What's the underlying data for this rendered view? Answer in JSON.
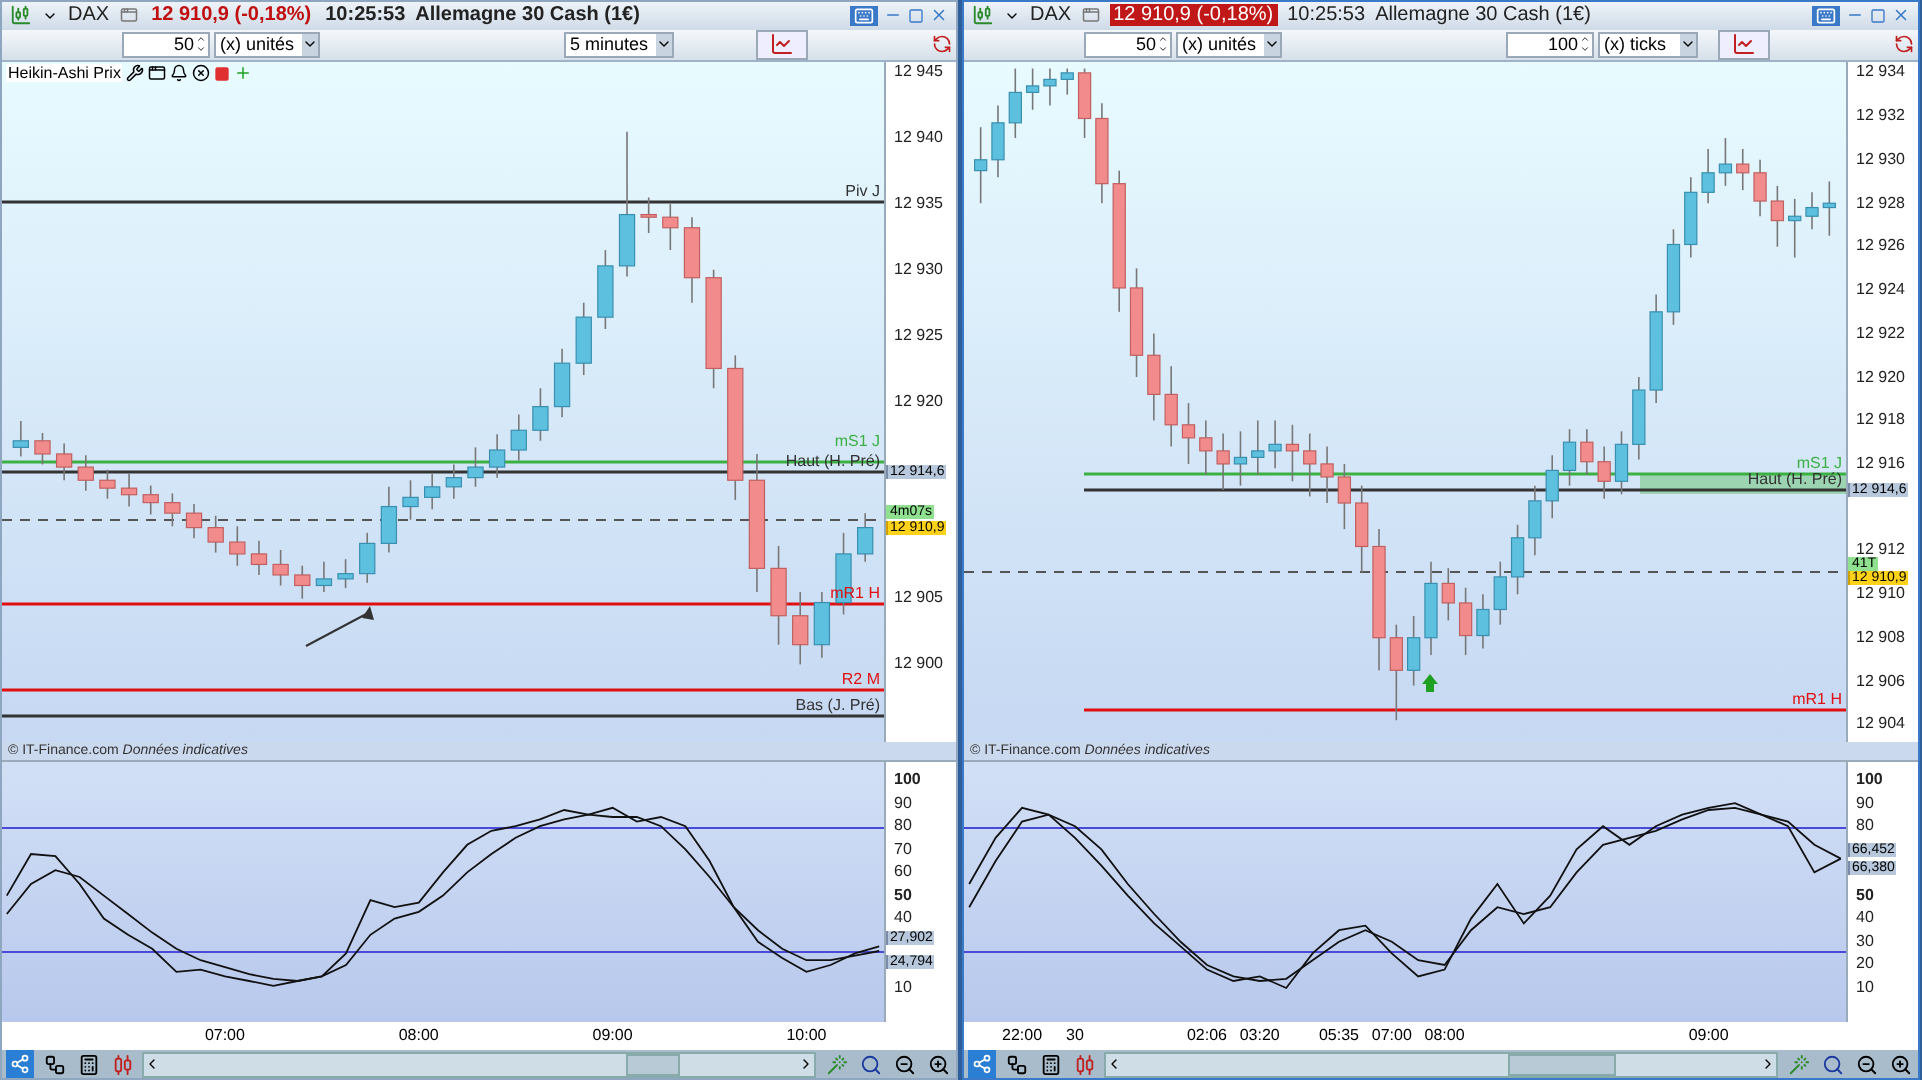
{
  "windows": [
    {
      "active": false,
      "title": {
        "symbol": "DAX",
        "quote": "12 910,9 (-0,18%)",
        "time": "10:25:53",
        "instrument": "Allemagne 30 Cash (1€)"
      },
      "toolbar": [
        {
          "kind": "spinner",
          "value": "50"
        },
        {
          "kind": "dropdown",
          "value": "(x) unités"
        },
        {
          "kind": "dropdown",
          "value": "5 minutes"
        }
      ],
      "indicator": "Heikin-Ashi Prix",
      "levels": [
        {
          "label": "Piv J",
          "color": "#333333"
        },
        {
          "label": "mS1 J",
          "color": "#3cb043"
        },
        {
          "label": "Haut (H. Pré)",
          "color": "#333333"
        },
        {
          "label": "mR1 H",
          "color": "#e01010"
        },
        {
          "label": "R2 M",
          "color": "#e01010"
        },
        {
          "label": "Bas (J. Pré)",
          "color": "#333333"
        }
      ],
      "price_chart": {
        "chart_data": {
          "type": "candlestick",
          "ylim": [
            12894.1,
            12945.8
          ],
          "yticks": [
            {
              "value": 12945,
              "label": "12 945"
            },
            {
              "value": 12940,
              "label": "12 940"
            },
            {
              "value": 12935,
              "label": "12 935"
            },
            {
              "value": 12930,
              "label": "12 930"
            },
            {
              "value": 12925,
              "label": "12 925"
            },
            {
              "value": 12920,
              "label": "12 920"
            },
            {
              "value": 12905,
              "label": "12 905"
            },
            {
              "value": 12900,
              "label": "12 900"
            }
          ],
          "categories": [
            null,
            null,
            null,
            null,
            null,
            null,
            null,
            null,
            null,
            null,
            null,
            null,
            null,
            null,
            null,
            null,
            null,
            null,
            null,
            null,
            null,
            null,
            null,
            null,
            null,
            null,
            null,
            null,
            null,
            null,
            null,
            null,
            null,
            null,
            null,
            null,
            null,
            null,
            null,
            null
          ],
          "ohlc": [
            [
              12916.5,
              12918.5,
              12915.8,
              12917.0
            ],
            [
              12917.0,
              12917.6,
              12915.2,
              12916.0
            ],
            [
              12916.0,
              12916.8,
              12914.0,
              12915.0
            ],
            [
              12915.0,
              12915.9,
              12913.2,
              12914.0
            ],
            [
              12914.0,
              12914.8,
              12912.6,
              12913.4
            ],
            [
              12913.4,
              12914.5,
              12912.0,
              12912.9
            ],
            [
              12912.9,
              12913.6,
              12911.4,
              12912.3
            ],
            [
              12912.3,
              12913.0,
              12910.5,
              12911.5
            ],
            [
              12911.5,
              12912.2,
              12909.6,
              12910.4
            ],
            [
              12910.4,
              12911.3,
              12908.5,
              12909.3
            ],
            [
              12909.3,
              12910.5,
              12907.5,
              12908.4
            ],
            [
              12908.4,
              12909.4,
              12906.8,
              12907.6
            ],
            [
              12907.6,
              12908.7,
              12906.0,
              12906.8
            ],
            [
              12906.8,
              12907.5,
              12905.0,
              12906.0
            ],
            [
              12906.0,
              12907.8,
              12905.5,
              12906.5
            ],
            [
              12906.5,
              12908.0,
              12905.8,
              12906.9
            ],
            [
              12906.9,
              12910.0,
              12906.2,
              12909.2
            ],
            [
              12909.2,
              12913.5,
              12908.5,
              12912.0
            ],
            [
              12912.0,
              12914.0,
              12911.0,
              12912.7
            ],
            [
              12912.7,
              12914.5,
              12911.8,
              12913.5
            ],
            [
              12913.5,
              12915.2,
              12912.6,
              12914.2
            ],
            [
              12914.2,
              12916.5,
              12913.5,
              12915.0
            ],
            [
              12915.0,
              12917.5,
              12914.2,
              12916.3
            ],
            [
              12916.3,
              12919.0,
              12915.5,
              12917.8
            ],
            [
              12917.8,
              12921.0,
              12917.0,
              12919.6
            ],
            [
              12919.6,
              12924.0,
              12918.8,
              12922.9
            ],
            [
              12922.9,
              12927.5,
              12922.0,
              12926.4
            ],
            [
              12926.4,
              12931.5,
              12925.5,
              12930.3
            ],
            [
              12930.3,
              12940.5,
              12929.5,
              12934.2
            ],
            [
              12934.2,
              12935.5,
              12932.8,
              12934.0
            ],
            [
              12934.0,
              12935.0,
              12931.5,
              12933.2
            ],
            [
              12933.2,
              12934.0,
              12927.5,
              12929.4
            ],
            [
              12929.4,
              12930.0,
              12921.0,
              12922.5
            ],
            [
              12922.5,
              12923.5,
              12912.5,
              12914.0
            ],
            [
              12914.0,
              12916.0,
              12905.5,
              12907.3
            ],
            [
              12907.3,
              12909.0,
              12901.5,
              12903.7
            ],
            [
              12903.7,
              12905.5,
              12900.0,
              12901.5
            ],
            [
              12901.5,
              12905.5,
              12900.5,
              12904.7
            ],
            [
              12904.7,
              12910.0,
              12903.8,
              12908.4
            ],
            [
              12908.4,
              12911.5,
              12907.8,
              12910.4
            ]
          ]
        }
      },
      "price_labels": [
        {
          "text": "12 914,6",
          "kind": "level"
        },
        {
          "text": "4m07s",
          "kind": "timer"
        },
        {
          "text": "12 910,9",
          "kind": "last"
        }
      ],
      "source": "© IT-Finance.com *Données indicatives*",
      "oscillator": {
        "readouts": [
          "27,902",
          "24,794"
        ],
        "chart_data": {
          "type": "line",
          "ylim": [
            -4.7,
            107.8
          ],
          "yticks": [
            10,
            40,
            50,
            60,
            70,
            80,
            90,
            100
          ],
          "categories": [
            null,
            null,
            null,
            null,
            null,
            null,
            null,
            null,
            null,
            "07:00",
            null,
            null,
            null,
            null,
            null,
            null,
            null,
            "08:00",
            null,
            null,
            null,
            null,
            null,
            null,
            null,
            "09:00",
            null,
            null,
            null,
            null,
            null,
            null,
            null,
            "10:00",
            null,
            null,
            null
          ],
          "series": [
            {
              "color": "#111111",
              "values": [
                50,
                68,
                67,
                55,
                40,
                33,
                27,
                17,
                18,
                15,
                13,
                11,
                13,
                15,
                25,
                48,
                45,
                47,
                60,
                72,
                78,
                80,
                83,
                87,
                85,
                88,
                82,
                84,
                80,
                65,
                45,
                30,
                23,
                17,
                20,
                25,
                28
              ]
            },
            {
              "color": "#111111",
              "values": [
                42,
                55,
                61,
                58,
                50,
                42,
                34,
                27,
                22,
                19,
                16,
                14,
                13,
                15,
                20,
                33,
                40,
                43,
                50,
                60,
                68,
                75,
                80,
                83,
                85,
                84,
                84,
                80,
                70,
                58,
                45,
                35,
                27,
                22,
                22,
                24,
                26
              ]
            }
          ]
        }
      }
    },
    {
      "active": true,
      "title": {
        "symbol": "DAX",
        "quote": "12 910,9 (-0,18%)",
        "time": "10:25:53",
        "instrument": "Allemagne 30 Cash (1€)"
      },
      "toolbar": [
        {
          "kind": "spinner",
          "value": "50"
        },
        {
          "kind": "dropdown",
          "value": "(x) unités"
        },
        {
          "kind": "spinner",
          "value": "100"
        },
        {
          "kind": "dropdown",
          "value": "(x) ticks"
        }
      ],
      "levels": [
        {
          "label": "mS1 J",
          "color": "#3cb043"
        },
        {
          "label": "Haut (H. Pré)",
          "color": "#333333"
        },
        {
          "label": "mR1 H",
          "color": "#e01010"
        }
      ],
      "price_chart": {
        "chart_data": {
          "type": "candlestick",
          "ylim": [
            12903.2,
            12934.5
          ],
          "yticks": [
            {
              "value": 12934,
              "label": "12 934"
            },
            {
              "value": 12932,
              "label": "12 932"
            },
            {
              "value": 12930,
              "label": "12 930"
            },
            {
              "value": 12928,
              "label": "12 928"
            },
            {
              "value": 12926,
              "label": "12 926"
            },
            {
              "value": 12924,
              "label": "12 924"
            },
            {
              "value": 12922,
              "label": "12 922"
            },
            {
              "value": 12920,
              "label": "12 920"
            },
            {
              "value": 12918,
              "label": "12 918"
            },
            {
              "value": 12916,
              "label": "12 916"
            },
            {
              "value": 12912,
              "label": "12 912"
            },
            {
              "value": 12910,
              "label": "12 910"
            },
            {
              "value": 12908,
              "label": "12 908"
            },
            {
              "value": 12906,
              "label": "12 906"
            },
            {
              "value": 12904,
              "label": "12 904"
            }
          ],
          "categories": [
            null,
            null,
            null,
            null,
            null,
            null,
            null,
            null,
            null,
            null,
            null,
            null,
            null,
            null,
            null,
            null,
            null,
            null,
            null,
            null,
            null,
            null,
            null,
            null,
            null,
            null,
            null,
            null,
            null,
            null,
            null,
            null,
            null,
            null,
            null,
            null,
            null,
            null,
            null,
            null,
            null,
            null,
            null,
            null,
            null,
            null,
            null,
            null,
            null,
            null
          ],
          "ohlc": [
            [
              12929.5,
              12931.5,
              12928.0,
              12930.0
            ],
            [
              12930.0,
              12932.5,
              12929.2,
              12931.7
            ],
            [
              12931.7,
              12934.2,
              12931.0,
              12933.1
            ],
            [
              12933.1,
              12934.2,
              12932.3,
              12933.4
            ],
            [
              12933.4,
              12934.2,
              12932.5,
              12933.7
            ],
            [
              12933.7,
              12934.2,
              12933.0,
              12934.0
            ],
            [
              12934.0,
              12934.2,
              12931.0,
              12931.9
            ],
            [
              12931.9,
              12932.6,
              12928.0,
              12928.9
            ],
            [
              12928.9,
              12929.5,
              12923.0,
              12924.1
            ],
            [
              12924.1,
              12925.0,
              12920.0,
              12921.0
            ],
            [
              12921.0,
              12922.0,
              12918.0,
              12919.2
            ],
            [
              12919.2,
              12920.5,
              12916.8,
              12917.8
            ],
            [
              12917.8,
              12918.8,
              12916.0,
              12917.2
            ],
            [
              12917.2,
              12918.0,
              12915.5,
              12916.6
            ],
            [
              12916.6,
              12917.4,
              12914.8,
              12916.0
            ],
            [
              12916.0,
              12917.5,
              12915.0,
              12916.3
            ],
            [
              12916.3,
              12918.0,
              12915.5,
              12916.6
            ],
            [
              12916.6,
              12918.0,
              12915.8,
              12916.9
            ],
            [
              12916.9,
              12917.8,
              12915.2,
              12916.6
            ],
            [
              12916.6,
              12917.4,
              12914.5,
              12916.0
            ],
            [
              12916.0,
              12916.8,
              12914.2,
              12915.4
            ],
            [
              12915.4,
              12916.0,
              12913.0,
              12914.2
            ],
            [
              12914.2,
              12915.0,
              12911.0,
              12912.2
            ],
            [
              12912.2,
              12913.0,
              12906.5,
              12908.0
            ],
            [
              12908.0,
              12908.6,
              12904.2,
              12906.5
            ],
            [
              12906.5,
              12909.0,
              12905.8,
              12908.0
            ],
            [
              12908.0,
              12911.5,
              12907.2,
              12910.5
            ],
            [
              12910.5,
              12911.2,
              12908.8,
              12909.6
            ],
            [
              12909.6,
              12910.3,
              12907.2,
              12908.1
            ],
            [
              12908.1,
              12910.0,
              12907.5,
              12909.3
            ],
            [
              12909.3,
              12911.5,
              12908.6,
              12910.8
            ],
            [
              12910.8,
              12913.2,
              12910.0,
              12912.6
            ],
            [
              12912.6,
              12915.0,
              12911.8,
              12914.3
            ],
            [
              12914.3,
              12916.4,
              12913.5,
              12915.7
            ],
            [
              12915.7,
              12917.6,
              12915.0,
              12917.0
            ],
            [
              12917.0,
              12917.6,
              12915.5,
              12916.1
            ],
            [
              12916.1,
              12916.8,
              12914.4,
              12915.2
            ],
            [
              12915.2,
              12917.5,
              12914.6,
              12916.9
            ],
            [
              12916.9,
              12920.0,
              12916.2,
              12919.4
            ],
            [
              12919.4,
              12923.8,
              12918.8,
              12923.0
            ],
            [
              12923.0,
              12926.8,
              12922.4,
              12926.1
            ],
            [
              12926.1,
              12929.2,
              12925.5,
              12928.5
            ],
            [
              12928.5,
              12930.5,
              12928.0,
              12929.4
            ],
            [
              12929.4,
              12931.0,
              12928.8,
              12929.8
            ],
            [
              12929.8,
              12930.5,
              12928.6,
              12929.4
            ],
            [
              12929.4,
              12930.0,
              12927.4,
              12928.1
            ],
            [
              12928.1,
              12928.8,
              12926.0,
              12927.2
            ],
            [
              12927.2,
              12928.2,
              12925.5,
              12927.4
            ],
            [
              12927.4,
              12928.5,
              12926.8,
              12927.8
            ],
            [
              12927.8,
              12929.0,
              12926.5,
              12928.0
            ]
          ]
        }
      },
      "price_labels": [
        {
          "text": "12 914,6",
          "kind": "level"
        },
        {
          "text": "41T",
          "kind": "timer"
        },
        {
          "text": "12 910,9",
          "kind": "last"
        }
      ],
      "source": "© IT-Finance.com *Données indicatives*",
      "oscillator": {
        "readouts": [
          "66,452",
          "66,380"
        ],
        "chart_data": {
          "type": "line",
          "ylim": [
            -4.7,
            107.8
          ],
          "yticks": [
            10,
            20,
            30,
            40,
            50,
            80,
            90,
            100
          ],
          "categories": [
            null,
            null,
            "22:00",
            null,
            "30",
            null,
            null,
            null,
            null,
            "02:06",
            null,
            "03:20",
            null,
            null,
            "05:35",
            null,
            "07:00",
            null,
            "08:00",
            null,
            null,
            null,
            null,
            null,
            null,
            null,
            null,
            null,
            "09:00",
            null,
            null,
            null,
            null,
            null
          ],
          "series": [
            {
              "color": "#111111",
              "values": [
                55,
                75,
                88,
                85,
                75,
                63,
                50,
                38,
                28,
                18,
                13,
                15,
                10,
                25,
                35,
                37,
                25,
                15,
                18,
                40,
                55,
                38,
                50,
                70,
                80,
                72,
                80,
                85,
                88,
                90,
                85,
                80,
                60,
                66
              ]
            },
            {
              "color": "#111111",
              "values": [
                45,
                65,
                82,
                85,
                80,
                70,
                55,
                42,
                30,
                20,
                15,
                13,
                14,
                22,
                30,
                35,
                30,
                22,
                20,
                35,
                45,
                42,
                45,
                60,
                72,
                75,
                78,
                83,
                87,
                88,
                85,
                82,
                72,
                66
              ]
            }
          ]
        }
      }
    }
  ]
}
